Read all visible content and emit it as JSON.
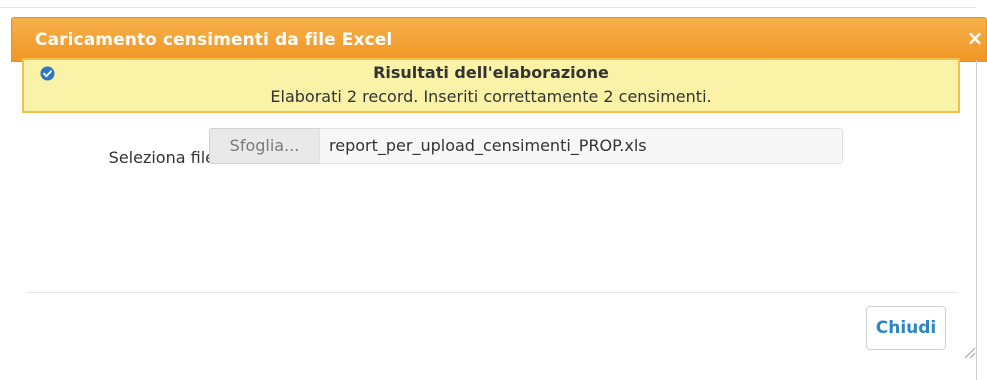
{
  "dialog": {
    "title": "Caricamento censimenti da file Excel",
    "close_glyph": "×",
    "close_icon": "close-icon"
  },
  "alert": {
    "icon": "check-circle-icon",
    "title": "Risultati dell'elaborazione",
    "message": "Elaborati 2 record. Inseriti correttamente 2 censimenti.",
    "background": "#faf2a7",
    "border": "#f2c14a"
  },
  "file": {
    "label": "Seleziona file",
    "browse_label": "Sfoglia...",
    "value": "report_per_upload_censimenti_PROP.xls"
  },
  "footer": {
    "close_label": "Chiudi"
  },
  "colors": {
    "titlebar": "#f09624",
    "accent_blue": "#2c87c2"
  }
}
